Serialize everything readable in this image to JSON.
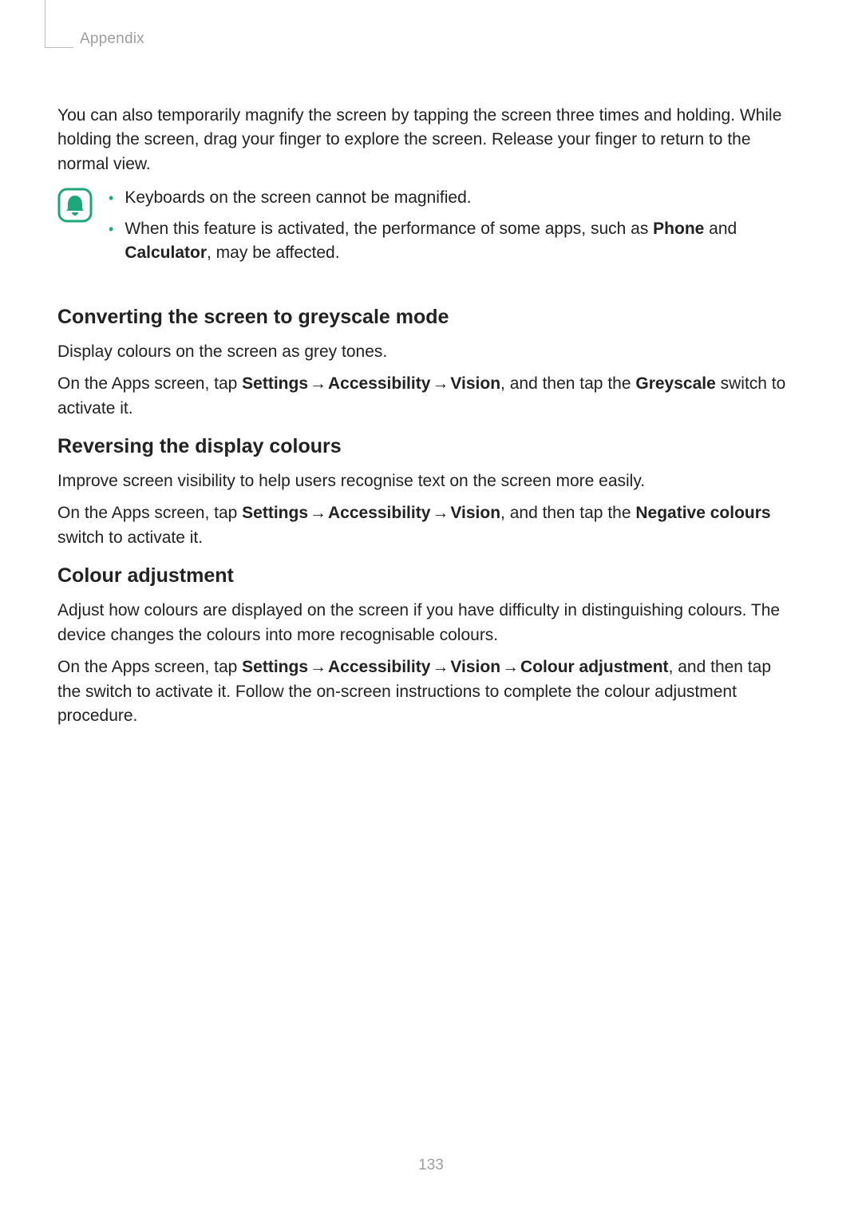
{
  "runningHead": "Appendix",
  "introPara": "You can also temporarily magnify the screen by tapping the screen three times and holding. While holding the screen, drag your finger to explore the screen. Release your finger to return to the normal view.",
  "note": {
    "bullets": [
      {
        "plain": "Keyboards on the screen cannot be magnified."
      },
      {
        "pre": "When this feature is activated, the performance of some apps, such as ",
        "b1": "Phone",
        "mid": " and ",
        "b2": "Calculator",
        "post": ", may be affected."
      }
    ]
  },
  "sections": {
    "greyscale": {
      "heading": "Converting the screen to greyscale mode",
      "p1": "Display colours on the screen as grey tones.",
      "nav": {
        "pre": "On the Apps screen, tap ",
        "s1": "Settings",
        "s2": "Accessibility",
        "s3": "Vision",
        "mid": ", and then tap the ",
        "target": "Greyscale",
        "post": " switch to activate it."
      }
    },
    "reversing": {
      "heading": "Reversing the display colours",
      "p1": "Improve screen visibility to help users recognise text on the screen more easily.",
      "nav": {
        "pre": "On the Apps screen, tap ",
        "s1": "Settings",
        "s2": "Accessibility",
        "s3": "Vision",
        "mid": ", and then tap the ",
        "target": "Negative colours",
        "post": " switch to activate it."
      }
    },
    "colourAdj": {
      "heading": "Colour adjustment",
      "p1": "Adjust how colours are displayed on the screen if you have difficulty in distinguishing colours. The device changes the colours into more recognisable colours.",
      "nav": {
        "pre": "On the Apps screen, tap ",
        "s1": "Settings",
        "s2": "Accessibility",
        "s3": "Vision",
        "s4": "Colour adjustment",
        "post": ", and then tap the switch to activate it. Follow the on-screen instructions to complete the colour adjustment procedure."
      }
    }
  },
  "arrow": "→",
  "pageNumber": "133"
}
